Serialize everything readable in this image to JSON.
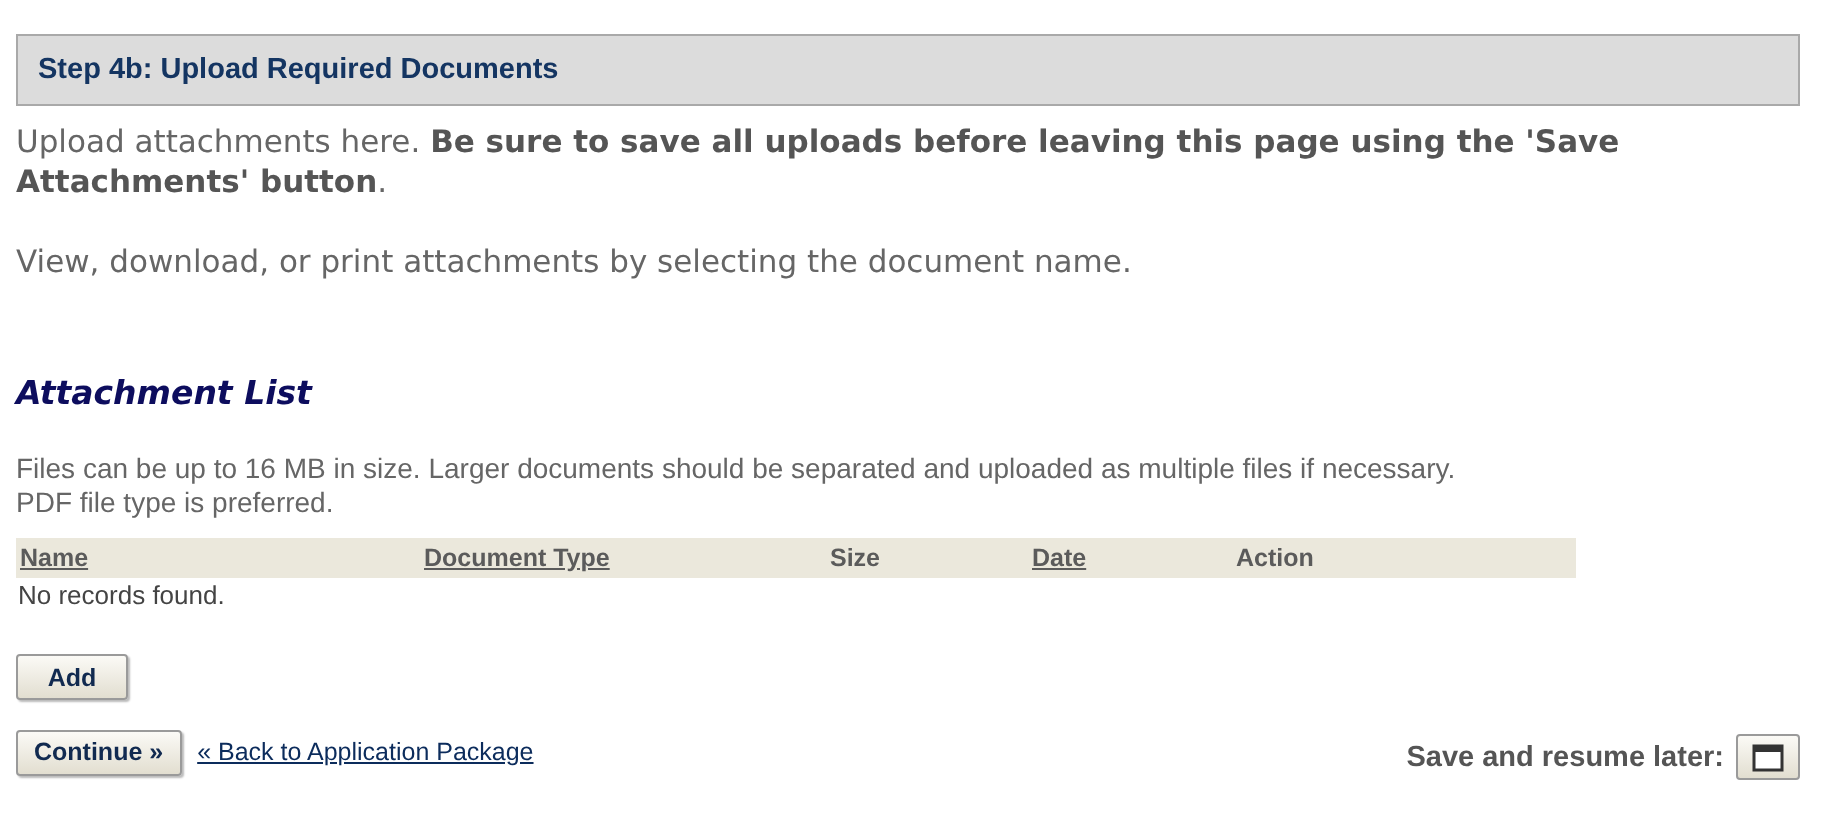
{
  "section_title": "Step 4b: Upload Required Documents",
  "intro": [
    "Upload attachments here. **Be sure to save all uploads before leaving this page using the 'Save Attachments' button**.",
    "View, download, or print attachments by selecting the document name."
  ],
  "attachments": {
    "title": "Attachment List",
    "note": [
      "Files can be up to 16 MB in size. Larger documents should be separated and uploaded as multiple files if necessary.",
      "PDF file type is preferred."
    ],
    "columns": [
      {
        "label": "Name",
        "sortable": true
      },
      {
        "label": "Document Type",
        "sortable": true
      },
      {
        "label": "Size",
        "sortable": false
      },
      {
        "label": "Date",
        "sortable": true
      },
      {
        "label": "Action",
        "sortable": false
      }
    ],
    "empty_message": "No records found.",
    "add_button": "Add"
  },
  "continue_button": "Continue »",
  "back_link": "« Back to Application Package",
  "save_label": "Save and resume later:"
}
